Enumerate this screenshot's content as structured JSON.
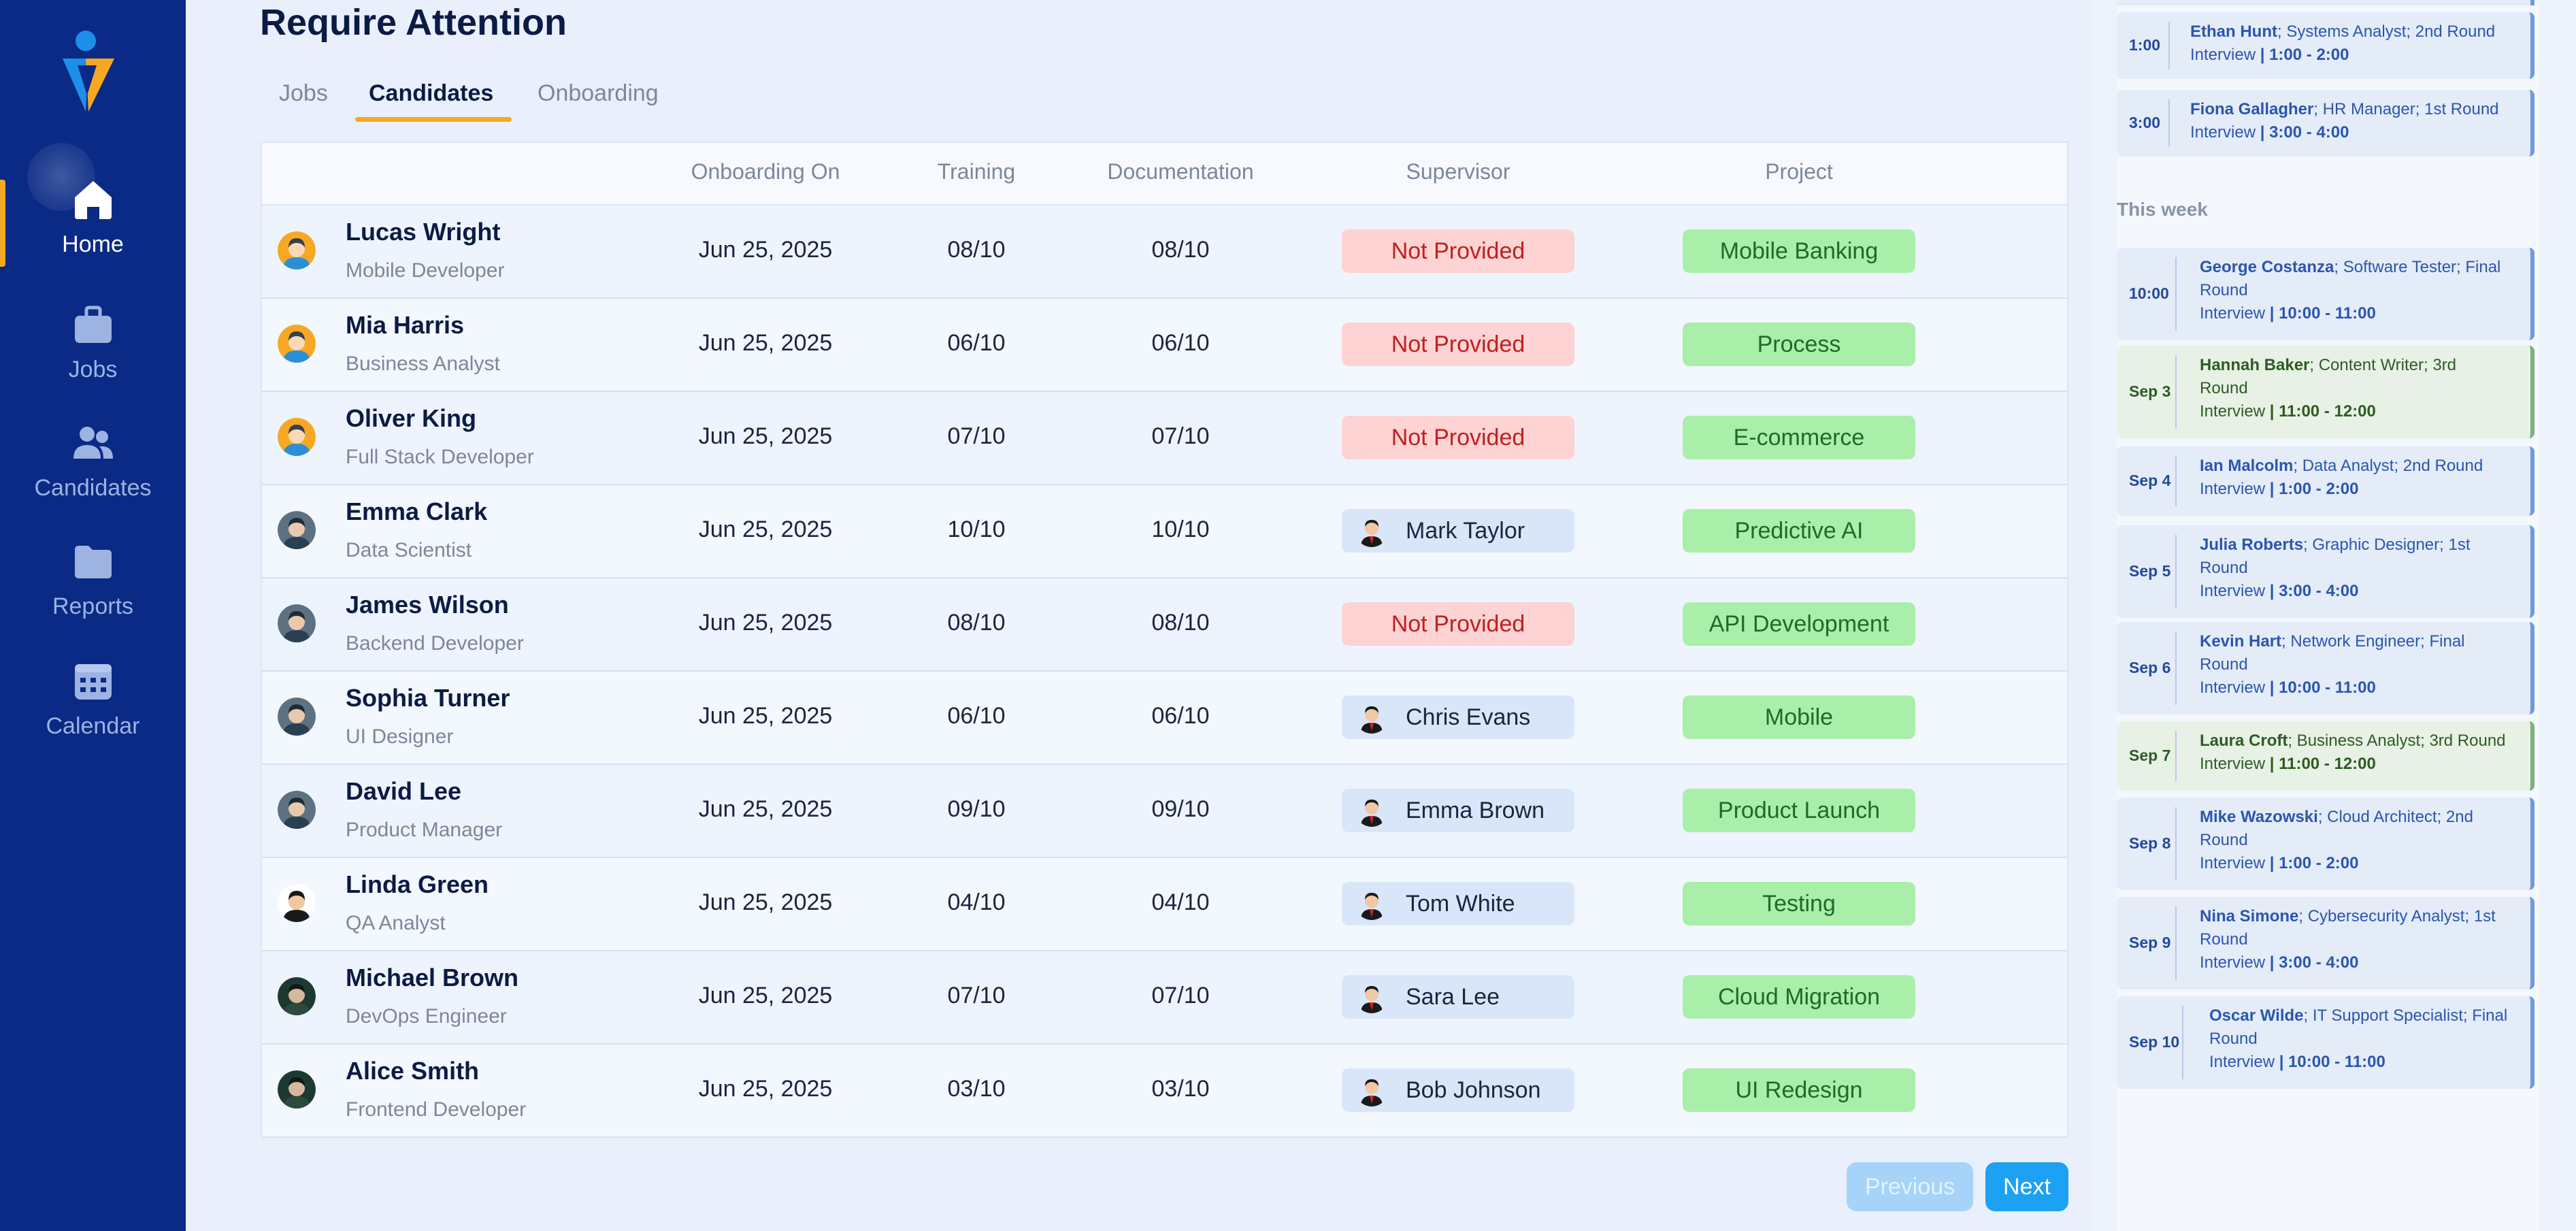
{
  "sidebar": {
    "items": [
      {
        "label": "Home",
        "icon": "home-icon",
        "active": true
      },
      {
        "label": "Jobs",
        "icon": "briefcase-icon",
        "active": false
      },
      {
        "label": "Candidates",
        "icon": "users-icon",
        "active": false
      },
      {
        "label": "Reports",
        "icon": "folder-icon",
        "active": false
      },
      {
        "label": "Calendar",
        "icon": "calendar-icon",
        "active": false
      }
    ],
    "colors": {
      "background": "#0a2a85",
      "accent": "#f7a823"
    }
  },
  "main": {
    "title": "Require Attention",
    "tabs": [
      "Jobs",
      "Candidates",
      "Onboarding"
    ],
    "active_tab": "Candidates",
    "columns": [
      "Onboarding On",
      "Training",
      "Documentation",
      "Supervisor",
      "Project"
    ],
    "rows": [
      {
        "name": "Lucas Wright",
        "role": "Mobile Developer",
        "onboarding": "Jun 25, 2025",
        "training": "08/10",
        "documentation": "08/10",
        "supervisor": "Not Provided",
        "supervisor_provided": false,
        "project": "Mobile Banking",
        "avatar": "orange"
      },
      {
        "name": "Mia Harris",
        "role": "Business Analyst",
        "onboarding": "Jun 25, 2025",
        "training": "06/10",
        "documentation": "06/10",
        "supervisor": "Not Provided",
        "supervisor_provided": false,
        "project": "Process",
        "avatar": "orange"
      },
      {
        "name": "Oliver King",
        "role": "Full Stack Developer",
        "onboarding": "Jun 25, 2025",
        "training": "07/10",
        "documentation": "07/10",
        "supervisor": "Not Provided",
        "supervisor_provided": false,
        "project": "E-commerce",
        "avatar": "orange"
      },
      {
        "name": "Emma Clark",
        "role": "Data Scientist",
        "onboarding": "Jun 25, 2025",
        "training": "10/10",
        "documentation": "10/10",
        "supervisor": "Mark Taylor",
        "supervisor_provided": true,
        "project": "Predictive AI",
        "avatar": "grey"
      },
      {
        "name": "James Wilson",
        "role": "Backend Developer",
        "onboarding": "Jun 25, 2025",
        "training": "08/10",
        "documentation": "08/10",
        "supervisor": "Not Provided",
        "supervisor_provided": false,
        "project": "API Development",
        "avatar": "grey"
      },
      {
        "name": "Sophia Turner",
        "role": "UI Designer",
        "onboarding": "Jun 25, 2025",
        "training": "06/10",
        "documentation": "06/10",
        "supervisor": "Chris Evans",
        "supervisor_provided": true,
        "project": "Mobile",
        "avatar": "grey"
      },
      {
        "name": "David Lee",
        "role": "Product Manager",
        "onboarding": "Jun 25, 2025",
        "training": "09/10",
        "documentation": "09/10",
        "supervisor": "Emma Brown",
        "supervisor_provided": true,
        "project": "Product Launch",
        "avatar": "grey"
      },
      {
        "name": "Linda Green",
        "role": "QA Analyst",
        "onboarding": "Jun 25, 2025",
        "training": "04/10",
        "documentation": "04/10",
        "supervisor": "Tom White",
        "supervisor_provided": true,
        "project": "Testing",
        "avatar": "suit"
      },
      {
        "name": "Michael Brown",
        "role": "DevOps Engineer",
        "onboarding": "Jun 25, 2025",
        "training": "07/10",
        "documentation": "07/10",
        "supervisor": "Sara Lee",
        "supervisor_provided": true,
        "project": "Cloud Migration",
        "avatar": "dark"
      },
      {
        "name": "Alice Smith",
        "role": "Frontend Developer",
        "onboarding": "Jun 25, 2025",
        "training": "03/10",
        "documentation": "03/10",
        "supervisor": "Bob Johnson",
        "supervisor_provided": true,
        "project": "UI Redesign",
        "avatar": "dark"
      }
    ],
    "pagination": {
      "previous": "Previous",
      "next": "Next"
    }
  },
  "schedule": {
    "today": [
      {
        "time": "1:00",
        "name": "Ethan Hunt",
        "detail": "; Systems Analyst; 2nd Round",
        "line2": "Interview ",
        "slot": "| 1:00 - 2:00",
        "style": "blue"
      },
      {
        "time": "3:00",
        "name": "Fiona Gallagher",
        "detail": "; HR Manager; 1st Round",
        "line2": "Interview ",
        "slot": "| 3:00 - 4:00",
        "style": "blue"
      }
    ],
    "this_week_label": "This week",
    "this_week": [
      {
        "time": "10:00",
        "name": "George Costanza",
        "detail": "; Software Tester; Final",
        "mid": "Round",
        "line2": "Interview ",
        "slot": "| 10:00 - 11:00",
        "style": "blue"
      },
      {
        "time": "Sep 3",
        "name": "Hannah Baker",
        "detail": "; Content Writer; 3rd",
        "mid": "Round",
        "line2": "Interview ",
        "slot": "| 11:00 - 12:00",
        "style": "green"
      },
      {
        "time": "Sep 4",
        "name": "Ian Malcolm",
        "detail": "; Data Analyst; 2nd Round",
        "mid": "",
        "line2": "Interview ",
        "slot": "| 1:00 - 2:00",
        "style": "blue"
      },
      {
        "time": "Sep 5",
        "name": "Julia Roberts",
        "detail": "; Graphic Designer; 1st",
        "mid": "Round",
        "line2": "Interview ",
        "slot": "| 3:00 - 4:00",
        "style": "blue"
      },
      {
        "time": "Sep 6",
        "name": "Kevin Hart",
        "detail": "; Network Engineer; Final",
        "mid": "Round",
        "line2": "Interview ",
        "slot": "| 10:00 - 11:00",
        "style": "blue"
      },
      {
        "time": "Sep 7",
        "name": "Laura Croft",
        "detail": "; Business Analyst; 3rd Round",
        "mid": "",
        "line2": "Interview ",
        "slot": "| 11:00 - 12:00",
        "style": "green"
      },
      {
        "time": "Sep 8",
        "name": "Mike Wazowski",
        "detail": "; Cloud Architect; 2nd",
        "mid": "Round",
        "line2": "Interview ",
        "slot": "| 1:00 - 2:00",
        "style": "blue"
      },
      {
        "time": "Sep 9",
        "name": "Nina Simone",
        "detail": "; Cybersecurity Analyst; 1st",
        "mid": "Round",
        "line2": "Interview ",
        "slot": "| 3:00 - 4:00",
        "style": "blue"
      },
      {
        "time": "Sep 10",
        "name": "Oscar Wilde",
        "detail": "; IT Support Specialist; Final",
        "mid": "Round",
        "line2": "Interview ",
        "slot": "| 10:00 - 11:00",
        "style": "blue"
      }
    ]
  }
}
